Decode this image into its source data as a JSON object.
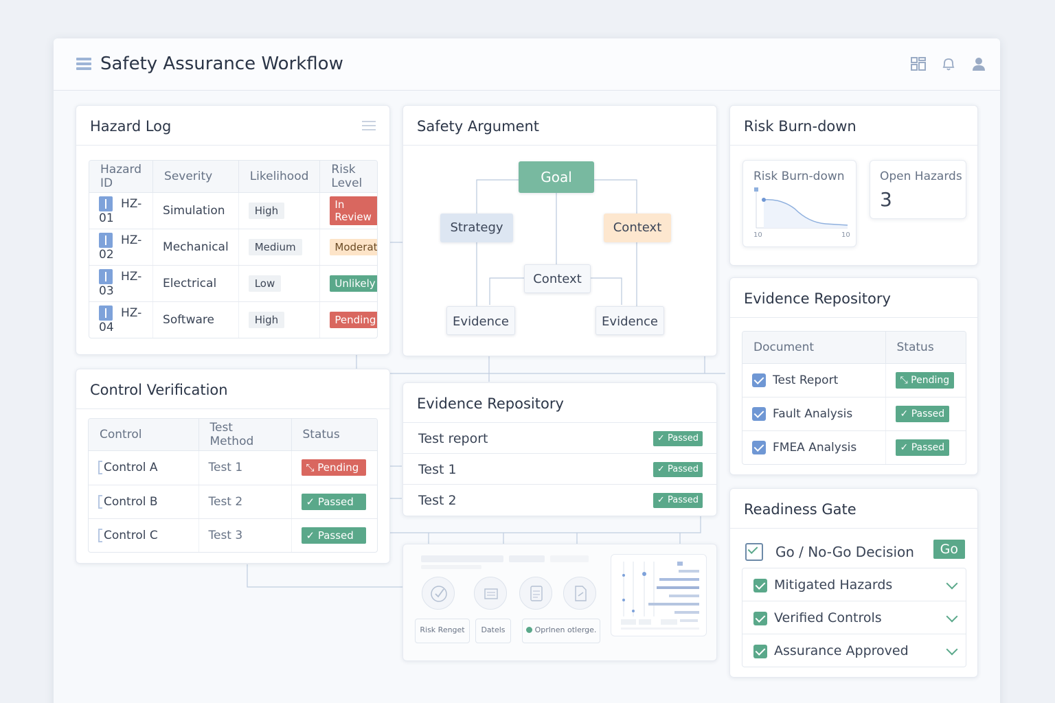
{
  "app": {
    "title": "Safety Assurance Workflow",
    "icons": [
      "dashboard-icon",
      "bell-icon",
      "user-icon"
    ]
  },
  "hazard_log": {
    "title": "Hazard Log",
    "columns": [
      "Hazard ID",
      "Severity",
      "Likelihood",
      "Risk Level"
    ],
    "rows": [
      {
        "id": "HZ-01",
        "severity": "Simulation",
        "likelihood": "High",
        "risk": "In Review",
        "risk_color": "#d9675f"
      },
      {
        "id": "HZ-02",
        "severity": "Mechanical",
        "likelihood": "Medium",
        "risk": "Moderate",
        "risk_color": "#fde4c8"
      },
      {
        "id": "HZ-03",
        "severity": "Electrical",
        "likelihood": "Low",
        "risk": "Unlikely",
        "risk_color": "#5aa88a"
      },
      {
        "id": "HZ-04",
        "severity": "Software",
        "likelihood": "High",
        "risk": "Pending",
        "risk_color": "#d9675f"
      }
    ]
  },
  "safety_argument": {
    "title": "Safety Argument",
    "nodes": {
      "goal": "Goal",
      "strategy": "Strategy",
      "context_right": "Context",
      "context_mid": "Context",
      "evidence_left": "Evidence",
      "evidence_right": "Evidence"
    }
  },
  "risk_burndown": {
    "title": "Risk Burn-down",
    "chart_title": "Risk Burn-down",
    "tick_left": "10",
    "tick_right": "10",
    "open_hazards_label": "Open Hazards",
    "open_hazards_value": "3"
  },
  "evidence_repo_right": {
    "title": "Evidence Repository",
    "columns": [
      "Document",
      "Status"
    ],
    "rows": [
      {
        "doc": "Test Report",
        "status": "Pending"
      },
      {
        "doc": "Fault Analysis",
        "status": "Passed"
      },
      {
        "doc": "FMEA Analysis",
        "status": "Passed"
      }
    ]
  },
  "control_verification": {
    "title": "Control Verification",
    "columns": [
      "Control",
      "Test Method",
      "Status"
    ],
    "rows": [
      {
        "control": "Control A",
        "method": "Test 1",
        "status": "Pending",
        "status_color": "#d9675f"
      },
      {
        "control": "Control B",
        "method": "Test 2",
        "status": "Passed",
        "status_color": "#5aa88a"
      },
      {
        "control": "Control C",
        "method": "Test 3",
        "status": "Passed",
        "status_color": "#5aa88a"
      }
    ]
  },
  "evidence_repo_mid": {
    "title": "Evidence Repository",
    "rows": [
      {
        "label": "Test report",
        "status": "Passed"
      },
      {
        "label": "Test 1",
        "status": "Passed"
      },
      {
        "label": "Test 2",
        "status": "Passed"
      }
    ]
  },
  "readiness_gate": {
    "title": "Readiness Gate",
    "decision_label": "Go / No-Go Decision",
    "decision_value": "Go",
    "items": [
      "Mitigated Hazards",
      "Verified Controls",
      "Assurance Approved"
    ]
  },
  "preview": {
    "pills": [
      "Risk Renget",
      "Datels",
      "Oprlnen otlerge."
    ]
  },
  "glyphs": {
    "check": "✓",
    "pending": "⤡"
  }
}
